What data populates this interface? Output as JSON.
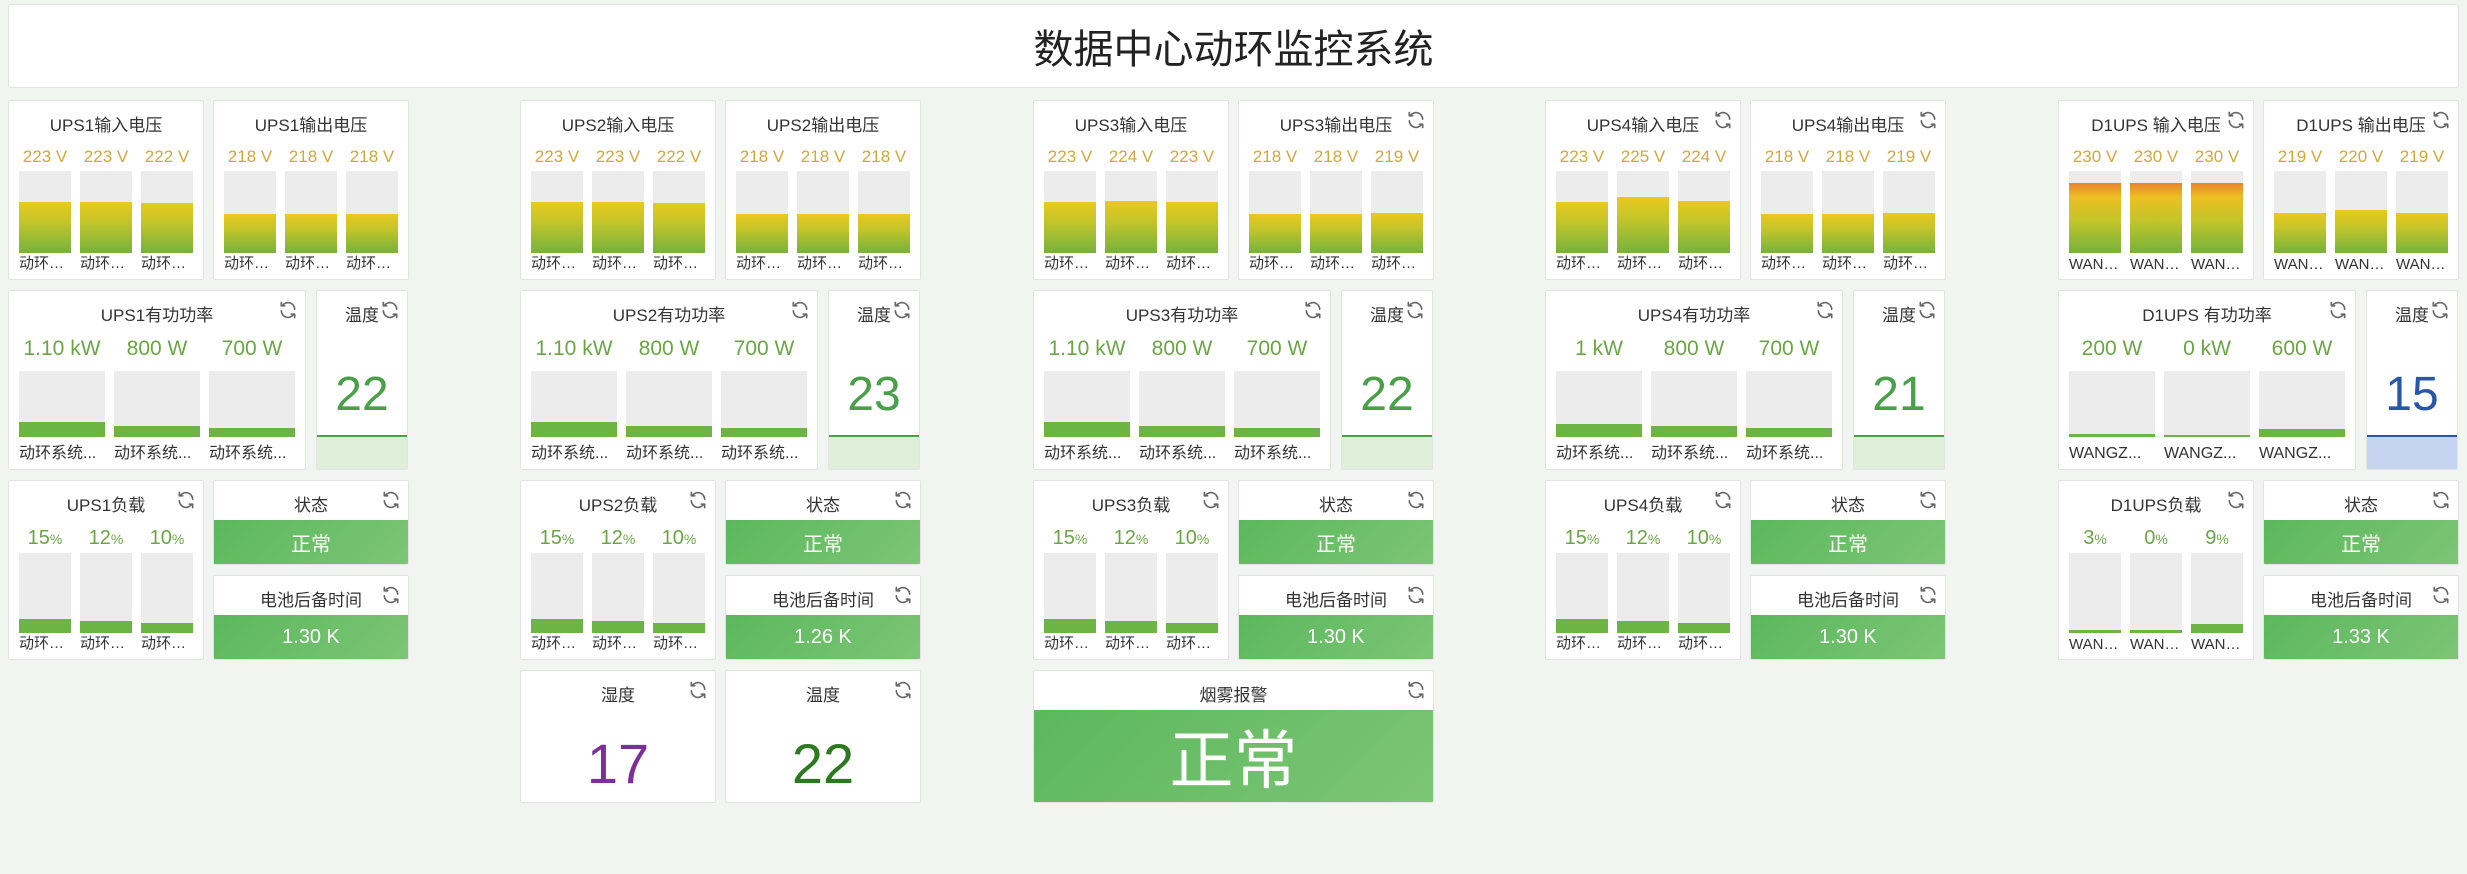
{
  "title": "数据中心动环监控系统",
  "columns": [
    {
      "input_voltage": {
        "title": "UPS1输入电压",
        "refresh": false,
        "bars": [
          {
            "value": "223 V",
            "level": 0.62,
            "label": "动环系统"
          },
          {
            "value": "223 V",
            "level": 0.62,
            "label": "动环系统"
          },
          {
            "value": "222 V",
            "level": 0.61,
            "label": "动环系统"
          }
        ]
      },
      "output_voltage": {
        "title": "UPS1输出电压",
        "refresh": false,
        "bars": [
          {
            "value": "218 V",
            "level": 0.48,
            "label": "动环系统"
          },
          {
            "value": "218 V",
            "level": 0.48,
            "label": "动环系统"
          },
          {
            "value": "218 V",
            "level": 0.48,
            "label": "动环系统"
          }
        ]
      },
      "power": {
        "title": "UPS1有功功率",
        "bars": [
          {
            "value": "1.10 kW",
            "level": 0.22,
            "label": "动环系统..."
          },
          {
            "value": "800 W",
            "level": 0.16,
            "label": "动环系统..."
          },
          {
            "value": "700 W",
            "level": 0.14,
            "label": "动环系统..."
          }
        ]
      },
      "temp": {
        "title": "温度",
        "value": "22",
        "color": "#48a048",
        "fill": "#deeed8"
      },
      "load": {
        "title": "UPS1负载",
        "bars": [
          {
            "value": "15",
            "unit": "%",
            "level": 0.18,
            "label": "动环系统"
          },
          {
            "value": "12",
            "unit": "%",
            "level": 0.15,
            "label": "动环系统"
          },
          {
            "value": "10",
            "unit": "%",
            "level": 0.12,
            "label": "动环系统"
          }
        ]
      },
      "status": {
        "title": "状态",
        "value": "正常"
      },
      "battery": {
        "title": "电池后备时间",
        "value": "1.30 K"
      }
    },
    {
      "input_voltage": {
        "title": "UPS2输入电压",
        "refresh": false,
        "bars": [
          {
            "value": "223 V",
            "level": 0.62,
            "label": "动环系统"
          },
          {
            "value": "223 V",
            "level": 0.62,
            "label": "动环系统"
          },
          {
            "value": "222 V",
            "level": 0.61,
            "label": "动环系统"
          }
        ]
      },
      "output_voltage": {
        "title": "UPS2输出电压",
        "refresh": false,
        "bars": [
          {
            "value": "218 V",
            "level": 0.48,
            "label": "动环系统"
          },
          {
            "value": "218 V",
            "level": 0.48,
            "label": "动环系统"
          },
          {
            "value": "218 V",
            "level": 0.48,
            "label": "动环系统"
          }
        ]
      },
      "power": {
        "title": "UPS2有功功率",
        "bars": [
          {
            "value": "1.10 kW",
            "level": 0.22,
            "label": "动环系统..."
          },
          {
            "value": "800 W",
            "level": 0.16,
            "label": "动环系统..."
          },
          {
            "value": "700 W",
            "level": 0.14,
            "label": "动环系统..."
          }
        ]
      },
      "temp": {
        "title": "温度",
        "value": "23",
        "color": "#48a048",
        "fill": "#deeed8"
      },
      "load": {
        "title": "UPS2负载",
        "bars": [
          {
            "value": "15",
            "unit": "%",
            "level": 0.18,
            "label": "动环系统"
          },
          {
            "value": "12",
            "unit": "%",
            "level": 0.15,
            "label": "动环系统"
          },
          {
            "value": "10",
            "unit": "%",
            "level": 0.12,
            "label": "动环系统"
          }
        ]
      },
      "status": {
        "title": "状态",
        "value": "正常"
      },
      "battery": {
        "title": "电池后备时间",
        "value": "1.26 K"
      },
      "extra_temp_a": {
        "title": "湿度",
        "value": "17",
        "color": "#7b2f9a"
      },
      "extra_temp_b": {
        "title": "温度",
        "value": "22",
        "color": "#2c7a1f"
      }
    },
    {
      "input_voltage": {
        "title": "UPS3输入电压",
        "refresh": false,
        "bars": [
          {
            "value": "223 V",
            "level": 0.62,
            "label": "动环系统"
          },
          {
            "value": "224 V",
            "level": 0.63,
            "label": "动环系统"
          },
          {
            "value": "223 V",
            "level": 0.62,
            "label": "动环系统"
          }
        ]
      },
      "output_voltage": {
        "title": "UPS3输出电压",
        "refresh": true,
        "bars": [
          {
            "value": "218 V",
            "level": 0.48,
            "label": "动环系统"
          },
          {
            "value": "218 V",
            "level": 0.48,
            "label": "动环系统"
          },
          {
            "value": "219 V",
            "level": 0.49,
            "label": "动环系统"
          }
        ]
      },
      "power": {
        "title": "UPS3有功功率",
        "bars": [
          {
            "value": "1.10 kW",
            "level": 0.22,
            "label": "动环系统..."
          },
          {
            "value": "800 W",
            "level": 0.16,
            "label": "动环系统..."
          },
          {
            "value": "700 W",
            "level": 0.14,
            "label": "动环系统..."
          }
        ]
      },
      "temp": {
        "title": "温度",
        "value": "22",
        "color": "#48a048",
        "fill": "#deeed8"
      },
      "load": {
        "title": "UPS3负载",
        "bars": [
          {
            "value": "15",
            "unit": "%",
            "level": 0.18,
            "label": "动环系统"
          },
          {
            "value": "12",
            "unit": "%",
            "level": 0.15,
            "label": "动环系统"
          },
          {
            "value": "10",
            "unit": "%",
            "level": 0.12,
            "label": "动环系统"
          }
        ]
      },
      "status": {
        "title": "状态",
        "value": "正常"
      },
      "battery": {
        "title": "电池后备时间",
        "value": "1.30 K"
      },
      "smoke": {
        "title": "烟雾报警",
        "value": "正常"
      }
    },
    {
      "input_voltage": {
        "title": "UPS4输入电压",
        "refresh": true,
        "bars": [
          {
            "value": "223 V",
            "level": 0.62,
            "label": "动环系统"
          },
          {
            "value": "225 V",
            "level": 0.68,
            "label": "动环系统"
          },
          {
            "value": "224 V",
            "level": 0.63,
            "label": "动环系统"
          }
        ]
      },
      "output_voltage": {
        "title": "UPS4输出电压",
        "refresh": true,
        "bars": [
          {
            "value": "218 V",
            "level": 0.48,
            "label": "动环系统"
          },
          {
            "value": "218 V",
            "level": 0.48,
            "label": "动环系统"
          },
          {
            "value": "219 V",
            "level": 0.49,
            "label": "动环系统"
          }
        ]
      },
      "power": {
        "title": "UPS4有功功率",
        "bars": [
          {
            "value": "1 kW",
            "level": 0.2,
            "label": "动环系统..."
          },
          {
            "value": "800 W",
            "level": 0.16,
            "label": "动环系统..."
          },
          {
            "value": "700 W",
            "level": 0.14,
            "label": "动环系统..."
          }
        ]
      },
      "temp": {
        "title": "温度",
        "value": "21",
        "color": "#48a048",
        "fill": "#deeed8"
      },
      "load": {
        "title": "UPS4负载",
        "bars": [
          {
            "value": "15",
            "unit": "%",
            "level": 0.18,
            "label": "动环系统"
          },
          {
            "value": "12",
            "unit": "%",
            "level": 0.15,
            "label": "动环系统"
          },
          {
            "value": "10",
            "unit": "%",
            "level": 0.12,
            "label": "动环系统"
          }
        ]
      },
      "status": {
        "title": "状态",
        "value": "正常"
      },
      "battery": {
        "title": "电池后备时间",
        "value": "1.30 K"
      }
    },
    {
      "input_voltage": {
        "title": "D1UPS 输入电压",
        "refresh": true,
        "bars": [
          {
            "value": "230 V",
            "level": 0.85,
            "label": "WANGZHAN",
            "hot": true
          },
          {
            "value": "230 V",
            "level": 0.85,
            "label": "WANGZHAN",
            "hot": true
          },
          {
            "value": "230 V",
            "level": 0.85,
            "label": "WANGZHAN",
            "hot": true
          }
        ]
      },
      "output_voltage": {
        "title": "D1UPS 输出电压",
        "refresh": true,
        "bars": [
          {
            "value": "219 V",
            "level": 0.49,
            "label": "WANGZHAN"
          },
          {
            "value": "220 V",
            "level": 0.52,
            "label": "WANGZHAN"
          },
          {
            "value": "219 V",
            "level": 0.49,
            "label": "WANGZHAN"
          }
        ]
      },
      "power": {
        "title": "D1UPS 有功功率",
        "bars": [
          {
            "value": "200 W",
            "level": 0.04,
            "label": "WANGZ..."
          },
          {
            "value": "0 kW",
            "level": 0.0,
            "label": "WANGZ..."
          },
          {
            "value": "600 W",
            "level": 0.12,
            "label": "WANGZ..."
          }
        ]
      },
      "temp": {
        "title": "温度",
        "value": "15",
        "color": "#2857a8",
        "fill": "#c6d4f0"
      },
      "load": {
        "title": "D1UPS负载",
        "bars": [
          {
            "value": "3",
            "unit": "%",
            "level": 0.04,
            "label": "WANGZHAN"
          },
          {
            "value": "0",
            "unit": "%",
            "level": 0.0,
            "label": "WANGZHAN"
          },
          {
            "value": "9",
            "unit": "%",
            "level": 0.11,
            "label": "WANGZHAN"
          }
        ]
      },
      "status": {
        "title": "状态",
        "value": "正常"
      },
      "battery": {
        "title": "电池后备时间",
        "value": "1.33 K"
      }
    }
  ]
}
